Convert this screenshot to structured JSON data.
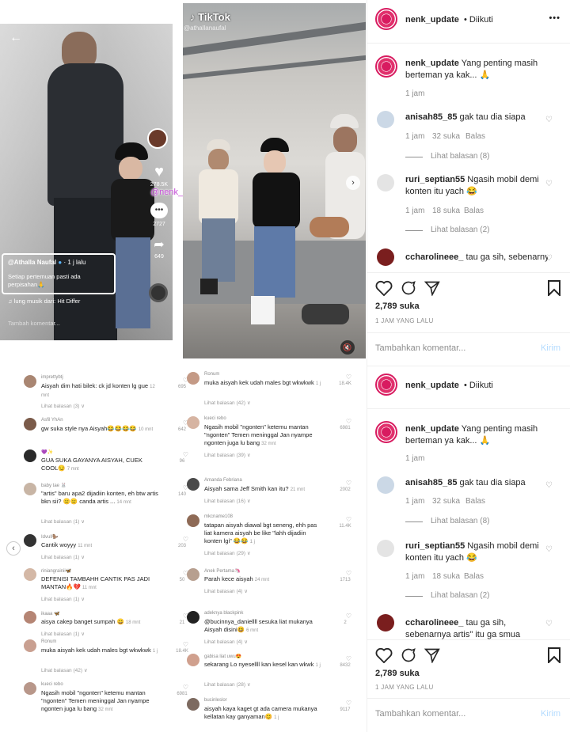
{
  "tiktok_video": {
    "watermark": "@nenk_update",
    "username": "@Athalla Naufal",
    "time": "· 1 j lalu",
    "caption": "Setiap pertemuan pasti ada perpisahan🙏",
    "music": "♫  lung musik dari: Hit Differ",
    "comment_placeholder": "Tambah komentar...",
    "likes": "278.5K",
    "comments": "2727",
    "shares": "649"
  },
  "tiktok_photo": {
    "logo": "TikTok",
    "handle": "@athallanaufal"
  },
  "tiktok_comments_left": [
    {
      "user": "imprettybtj",
      "text": "Aisyah dim hati bilek: ck jd konten lg gue",
      "time": "12 mnt",
      "likes": "695",
      "replies": "Lihat balasan (3) ∨"
    },
    {
      "user": "Asfil YhAn",
      "text": "gw suka style nya Aisyah😂😂😂😂",
      "time": "10 mnt",
      "likes": "642",
      "replies": ""
    },
    {
      "user": "💜✨",
      "text": "GUA SUKA GAYANYA AISYAH, CUEK COOL😏",
      "time": "7 mnt",
      "likes": "96",
      "replies": ""
    },
    {
      "user": "baby tae 🐰",
      "text": "\"artis\" baru apa2 dijadiin konten, eh btw artis bkn sii? 😑😑 canda artis ...",
      "time": "14 mnt",
      "likes": "140",
      "replies": "Lihat balasan (1) ∨"
    },
    {
      "user": "Idvull🦫",
      "text": "Cantik woyyy",
      "time": "11 mnt",
      "likes": "203",
      "replies": "Lihat balasan (1) ∨"
    },
    {
      "user": "riniangrainii🦋",
      "text": "DEFENISI TAMBAHH CANTIK PAS JADI MANTAN🔥💔",
      "time": "11 mnt",
      "likes": "50",
      "replies": "Lihat balasan (1) ∨"
    },
    {
      "user": "ikaaa 🦋",
      "text": "aisya cakep banget sumpah 😄",
      "time": "18 mnt",
      "likes": "21",
      "replies": "Lihat balasan (1) ∨"
    },
    {
      "user": "Ronum",
      "text": "muka aisyah kek udah males bgt wkwkwk",
      "time": "1 j",
      "likes": "18.4K",
      "replies": "Lihat balasan (42) ∨"
    },
    {
      "user": "kueci rebo",
      "text": "Ngasih mobil \"ngonten\" ketemu mantan \"ngonten\" Temen meninggal Jan nyampe ngonten juga lu bang",
      "time": "32 mnt",
      "likes": "6981",
      "replies": ""
    }
  ],
  "tiktok_comments_right": [
    {
      "user": "Ronum",
      "text": "muka aisyah kek udah males bgt wkwkwk",
      "time": "1 j",
      "likes": "18.4K",
      "replies": "Lihat balasan (42) ∨"
    },
    {
      "user": "kueci rebo",
      "text": "Ngasih mobil \"ngonten\" ketemu mantan \"ngonten\" Temen meninggal Jan nyampe ngonten juga lu bang",
      "time": "32 mnt",
      "likes": "6981",
      "replies": "Lihat balasan (39) ∨"
    },
    {
      "user": "Amanda Febriana",
      "text": "Aisyah sama Jeff Smith kan itu?",
      "time": "21 mnt",
      "likes": "2002",
      "replies": "Lihat balasan (16) ∨"
    },
    {
      "user": "mkcname108",
      "text": "tatapan aisyah diawal bgt seneng, ehh pas liat kamera aisyah be like \"lahh dijadiin konten lgi\" 😂😂",
      "time": "1 j",
      "likes": "11.4K",
      "replies": "Lihat balasan (29) ∨"
    },
    {
      "user": "Anek Pertama🦄",
      "text": "Parah kece aisyah",
      "time": "24 mnt",
      "likes": "1713",
      "replies": "Lihat balasan (4) ∨"
    },
    {
      "user": "adeknya blackpink",
      "text": "@bucinnya_daniellll sesuka liat mukanya Aisyah disini😆",
      "time": "6 mnt",
      "likes": "2",
      "replies": "Lihat balasan (4) ∨"
    },
    {
      "user": "gabisa liat uwu😍",
      "text": "sekarang Lo nyesellll kan kesel kan wkwk",
      "time": "1 j",
      "likes": "8432",
      "replies": "Lihat balasan (28) ∨"
    },
    {
      "user": "bucinleslor",
      "text": "aisyah kaya kaget gt ada camera mukanya kellatan kay ganyaman😊",
      "time": "1 j",
      "likes": "9117",
      "replies": ""
    }
  ],
  "instagram": {
    "username": "nenk_update",
    "follow_status": "• Diikuti",
    "caption": "Yang penting masih berteman ya kak... 🙏",
    "caption_time": "1 jam",
    "comments": [
      {
        "user": "anisah85_85",
        "text": "gak tau dia siapa",
        "time": "1 jam",
        "likes": "32 suka",
        "reply": "Balas",
        "view_replies": "Lihat balasan (8)"
      },
      {
        "user": "ruri_septian55",
        "text": "Ngasih mobil demi konten itu yach 😂",
        "time": "1 jam",
        "likes": "18 suka",
        "reply": "Balas",
        "view_replies": "Lihat balasan (2)"
      },
      {
        "user": "ccharolineee_",
        "text": "tau ga sih, sebenarnya artis\" itu ga smua",
        "time": "",
        "likes": "",
        "reply": "",
        "view_replies": ""
      }
    ],
    "like_count": "2,789 suka",
    "post_time": "1 JAM YANG LALU",
    "add_comment_placeholder": "Tambahkan komentar...",
    "post_button": "Kirim"
  },
  "colors": {
    "accent_blue": "#0095f6",
    "watermark": "#c44bd6",
    "muted": "#8e8e8e"
  }
}
